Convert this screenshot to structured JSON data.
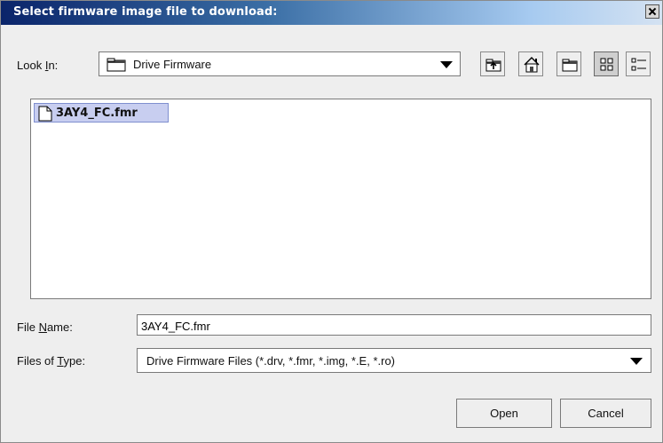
{
  "dialog": {
    "title": "Select firmware image file to download:"
  },
  "look_in": {
    "label_prefix": "Look ",
    "label_mnemonic": "I",
    "label_suffix": "n:",
    "value": "Drive Firmware"
  },
  "toolbar": {
    "icons": [
      "up-one-level-icon",
      "home-icon",
      "new-folder-icon",
      "list-view-icon",
      "details-view-icon"
    ]
  },
  "files": [
    {
      "name": "3AY4_FC.fmr",
      "selected": true
    }
  ],
  "file_name": {
    "label_prefix": "File ",
    "label_mnemonic": "N",
    "label_suffix": "ame:",
    "value": "3AY4_FC.fmr"
  },
  "file_type": {
    "label_prefix": "Files of ",
    "label_mnemonic": "T",
    "label_suffix": "ype:",
    "value": "Drive Firmware Files (*.drv, *.fmr, *.img, *.E, *.ro)"
  },
  "buttons": {
    "open": "Open",
    "cancel": "Cancel"
  },
  "colors": {
    "title_gradient_start": "#0a246a",
    "title_gradient_end": "#d4e2f2",
    "selection": "#c8cef0",
    "dialog_bg": "#eeeeee"
  }
}
